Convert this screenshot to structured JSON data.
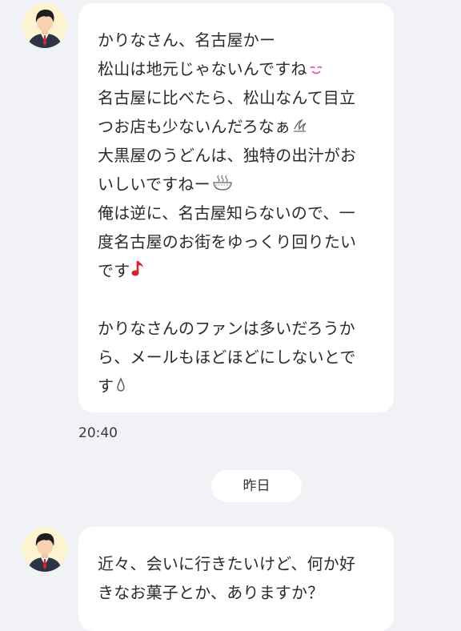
{
  "messages": [
    {
      "lines": [
        {
          "text": "かりなさん、名古屋かー",
          "emoji": ""
        },
        {
          "text": "松山は地元じゃないんですね",
          "emoji": "smile-emoji"
        },
        {
          "text": "名古屋に比べたら、松山なんて目立",
          "emoji": ""
        },
        {
          "text": "つお店も少ないんだろなぁ",
          "emoji": "sweat-emoji"
        },
        {
          "text": "大黒屋のうどんは、独特の出汁がお",
          "emoji": ""
        },
        {
          "text": "いしいですねー",
          "emoji": "noodle-bowl-emoji"
        },
        {
          "text": "俺は逆に、名古屋知らないので、一",
          "emoji": ""
        },
        {
          "text": "度名古屋のお街をゆっくり回りたい",
          "emoji": ""
        },
        {
          "text": "です",
          "emoji": "music-note-emoji"
        },
        {
          "text": "",
          "emoji": ""
        },
        {
          "text": "かりなさんのファンは多いだろうか",
          "emoji": ""
        },
        {
          "text": "ら、メールもほどほどにしないとで",
          "emoji": ""
        },
        {
          "text": "す",
          "emoji": "drop-emoji"
        }
      ],
      "time": "20:40"
    },
    {
      "lines": [
        {
          "text": "近々、会いに行きたいけど、何か好",
          "emoji": ""
        },
        {
          "text": "きなお菓子とか、ありますか？",
          "emoji": ""
        }
      ]
    }
  ],
  "date_separator": "昨日",
  "colors": {
    "background": "#f1f2f6",
    "bubble": "#ffffff",
    "smile_emoji": "#e85aa8",
    "music_note": "#d9252a"
  }
}
